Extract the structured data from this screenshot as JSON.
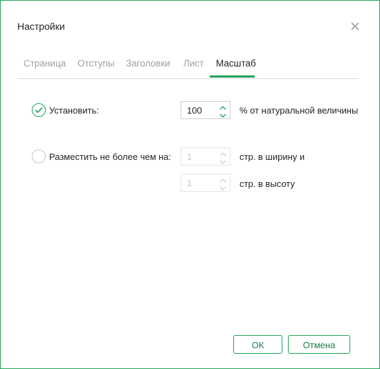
{
  "dialog": {
    "title": "Настройки",
    "close_icon": "close-icon"
  },
  "tabs": [
    {
      "label": "Страница",
      "active": false
    },
    {
      "label": "Отступы",
      "active": false
    },
    {
      "label": "Заголовки",
      "active": false
    },
    {
      "label": "Лист",
      "active": false
    },
    {
      "label": "Масштаб",
      "active": true
    }
  ],
  "scale": {
    "set_option": {
      "label": "Установить:",
      "checked": true
    },
    "set_value": "100",
    "set_suffix": "% от натуральной величины",
    "fit_option": {
      "label": "Разместить не более чем на:",
      "checked": false
    },
    "fit_width_value": "1",
    "fit_width_suffix": "стр. в ширину и",
    "fit_height_value": "1",
    "fit_height_suffix": "стр. в высоту"
  },
  "buttons": {
    "ok": "ОК",
    "cancel": "Отмена"
  },
  "colors": {
    "accent": "#1fa35a",
    "accent_text": "#1a7f45"
  }
}
